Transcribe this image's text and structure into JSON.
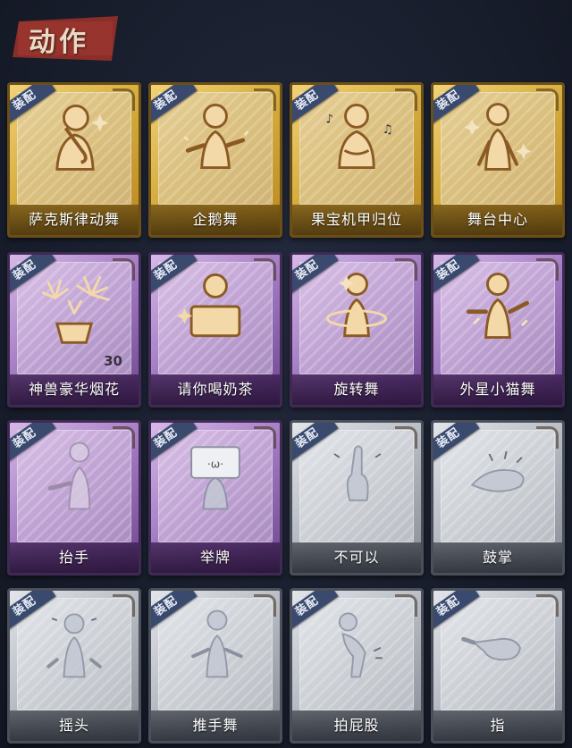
{
  "section": {
    "title": "动作"
  },
  "equip_badge": "装配",
  "cards": [
    {
      "label": "萨克斯律动舞",
      "rarity": "gold",
      "icon": "saxophone-dance-icon",
      "equipped": true
    },
    {
      "label": "企鹅舞",
      "rarity": "gold",
      "icon": "penguin-dance-icon",
      "equipped": true
    },
    {
      "label": "果宝机甲归位",
      "rarity": "gold",
      "icon": "mecha-pose-icon",
      "equipped": true
    },
    {
      "label": "舞台中心",
      "rarity": "gold",
      "icon": "stage-center-icon",
      "equipped": true
    },
    {
      "label": "神兽豪华烟花",
      "rarity": "purple",
      "icon": "fireworks-icon",
      "equipped": true,
      "count": "30"
    },
    {
      "label": "请你喝奶茶",
      "rarity": "purple",
      "icon": "milk-tea-icon",
      "equipped": true
    },
    {
      "label": "旋转舞",
      "rarity": "purple",
      "icon": "spin-dance-icon",
      "equipped": true
    },
    {
      "label": "外星小猫舞",
      "rarity": "purple",
      "icon": "alien-cat-dance-icon",
      "equipped": true
    },
    {
      "label": "抬手",
      "rarity": "purple",
      "icon": "raise-hand-icon",
      "equipped": true
    },
    {
      "label": "举牌",
      "rarity": "purple",
      "icon": "hold-sign-icon",
      "equipped": true
    },
    {
      "label": "不可以",
      "rarity": "gray",
      "icon": "finger-wag-icon",
      "equipped": true
    },
    {
      "label": "鼓掌",
      "rarity": "gray",
      "icon": "clap-icon",
      "equipped": true
    },
    {
      "label": "摇头",
      "rarity": "gray",
      "icon": "shake-head-icon",
      "equipped": true
    },
    {
      "label": "推手舞",
      "rarity": "gray",
      "icon": "push-hand-dance-icon",
      "equipped": true
    },
    {
      "label": "拍屁股",
      "rarity": "gray",
      "icon": "pat-butt-icon",
      "equipped": true
    },
    {
      "label": "指",
      "rarity": "gray",
      "icon": "point-icon",
      "equipped": true
    }
  ],
  "colors": {
    "gold": "#d6ad3f",
    "purple": "#a57ec4",
    "gray": "#b8bcc4",
    "badge": "#3a4a6e",
    "tab": "#8a2e29"
  }
}
